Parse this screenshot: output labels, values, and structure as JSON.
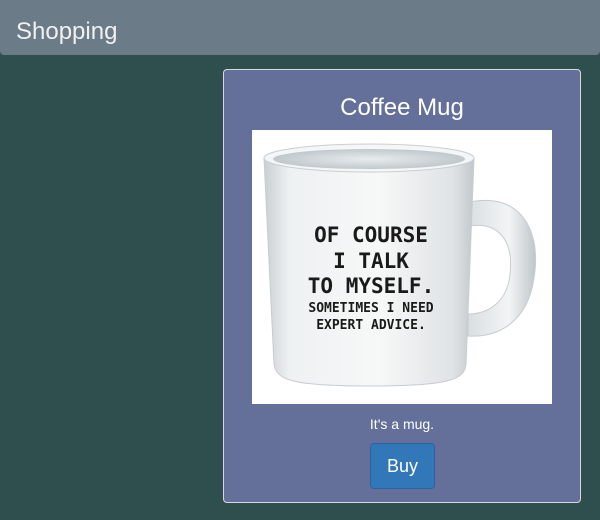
{
  "header": {
    "title": "Shopping"
  },
  "product": {
    "title": "Coffee Mug",
    "description": "It's a mug.",
    "buy_label": "Buy",
    "image": {
      "print_lines": [
        "OF COURSE",
        "I TALK",
        "TO MYSELF.",
        "SOMETIMES I NEED",
        "EXPERT ADVICE."
      ]
    }
  },
  "colors": {
    "page_background": "#2f4f4f",
    "header_background": "#6b7b87",
    "card_background": "#647099",
    "button_background": "#3277b8"
  }
}
